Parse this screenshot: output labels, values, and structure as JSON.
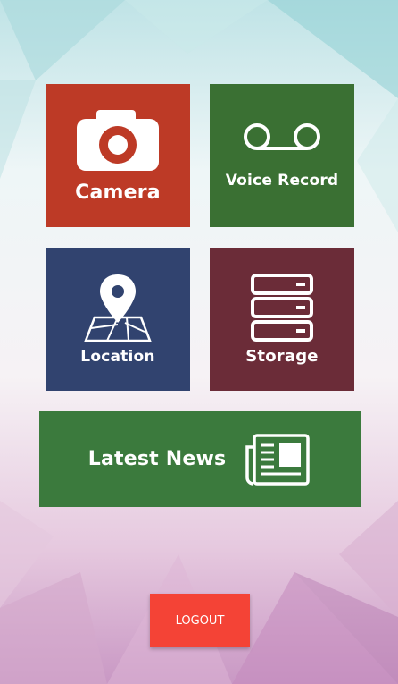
{
  "colors": {
    "camera_bg": "#bd3a26",
    "voice_bg": "#3a7033",
    "location_bg": "#31436f",
    "storage_bg": "#6b2c38",
    "news_bg": "#3b7a3d",
    "logout_bg": "#f44336"
  },
  "tiles": {
    "camera": {
      "label": "Camera",
      "icon": "camera-icon"
    },
    "voice": {
      "label": "Voice Record",
      "icon": "voicemail-icon"
    },
    "location": {
      "label": "Location",
      "icon": "map-pin-icon"
    },
    "storage": {
      "label": "Storage",
      "icon": "server-icon"
    },
    "news": {
      "label": "Latest News",
      "icon": "newspaper-icon"
    }
  },
  "logout": {
    "label": "LOGOUT"
  }
}
